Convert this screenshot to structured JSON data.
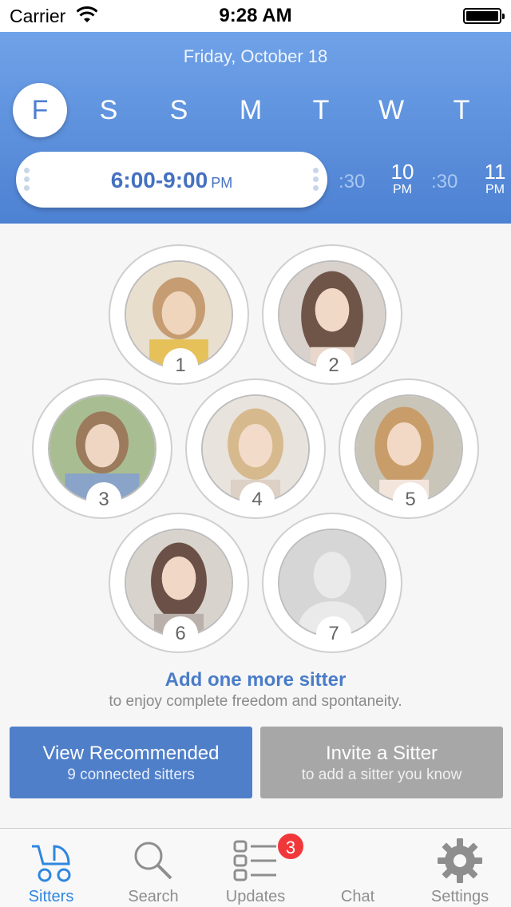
{
  "status_bar": {
    "carrier": "Carrier",
    "time": "9:28 AM"
  },
  "header": {
    "date": "Friday, October 18",
    "days": [
      "F",
      "S",
      "S",
      "M",
      "T",
      "W",
      "T"
    ],
    "selected_day_index": 0,
    "time_range": "6:00-9:00",
    "time_ampm": "PM",
    "ticks": [
      {
        "label": ":30"
      },
      {
        "label": "10",
        "ampm": "PM"
      },
      {
        "label": ":30"
      },
      {
        "label": "11",
        "ampm": "PM"
      }
    ]
  },
  "sitters": [
    {
      "number": "1"
    },
    {
      "number": "2"
    },
    {
      "number": "3"
    },
    {
      "number": "4"
    },
    {
      "number": "5"
    },
    {
      "number": "6"
    },
    {
      "number": "7"
    }
  ],
  "cta": {
    "title": "Add one more sitter",
    "subtitle": "to enjoy complete freedom and spontaneity."
  },
  "buttons": {
    "recommended_title": "View Recommended",
    "recommended_sub": "9 connected sitters",
    "invite_title": "Invite a Sitter",
    "invite_sub": "to add a sitter you know"
  },
  "tabs": [
    {
      "label": "Sitters",
      "icon": "stroller-icon",
      "active": true
    },
    {
      "label": "Search",
      "icon": "search-icon"
    },
    {
      "label": "Updates",
      "icon": "list-icon",
      "badge": "3"
    },
    {
      "label": "Chat",
      "icon": "chat-icon"
    },
    {
      "label": "Settings",
      "icon": "gear-icon"
    }
  ],
  "colors": {
    "header": "#5b8fdd",
    "accent": "#4a7cc8",
    "tab_active": "#2f86e0",
    "badge": "#f0383b"
  }
}
